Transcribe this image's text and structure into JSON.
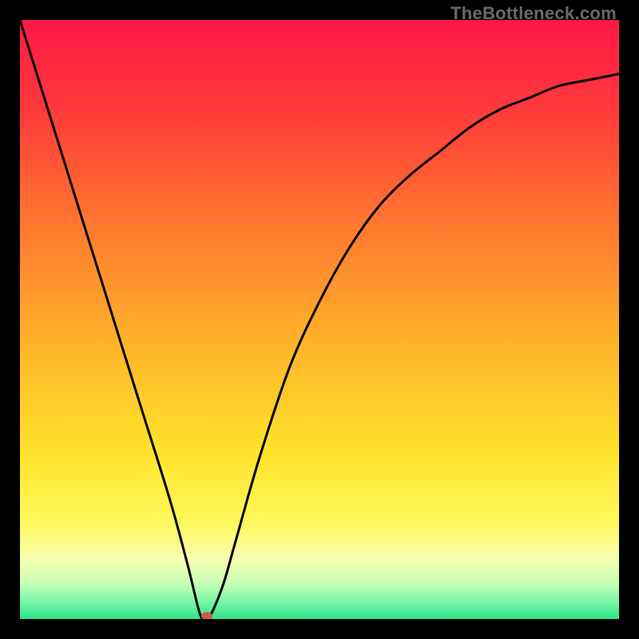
{
  "watermark": "TheBottleneck.com",
  "chart_data": {
    "type": "line",
    "title": "",
    "xlabel": "",
    "ylabel": "",
    "xlim": [
      0,
      100
    ],
    "ylim": [
      0,
      100
    ],
    "grid": false,
    "legend": false,
    "series": [
      {
        "name": "curve",
        "x": [
          0,
          5,
          10,
          15,
          20,
          25,
          28,
          30,
          31,
          32,
          34,
          36,
          40,
          45,
          50,
          55,
          60,
          65,
          70,
          75,
          80,
          85,
          90,
          95,
          100
        ],
        "y": [
          100,
          84,
          68,
          52,
          36,
          20,
          9,
          1,
          0,
          1,
          6,
          13,
          27,
          42,
          53,
          62,
          69,
          74,
          78,
          82,
          85,
          87,
          89,
          90,
          91
        ]
      }
    ],
    "marker": {
      "x": 31.2,
      "y": 0.5,
      "color": "#d05a4a",
      "rx": 7,
      "ry": 5
    },
    "gradient_stops": [
      {
        "offset": 0.0,
        "color": "#ff1846"
      },
      {
        "offset": 0.15,
        "color": "#ff3a3a"
      },
      {
        "offset": 0.35,
        "color": "#ff7a2f"
      },
      {
        "offset": 0.55,
        "color": "#ffb62a"
      },
      {
        "offset": 0.72,
        "color": "#ffe22a"
      },
      {
        "offset": 0.84,
        "color": "#fff85e"
      },
      {
        "offset": 0.9,
        "color": "#f6ffb0"
      },
      {
        "offset": 0.94,
        "color": "#c8ffb8"
      },
      {
        "offset": 0.97,
        "color": "#7cf7a8"
      },
      {
        "offset": 1.0,
        "color": "#2de38a"
      }
    ]
  }
}
